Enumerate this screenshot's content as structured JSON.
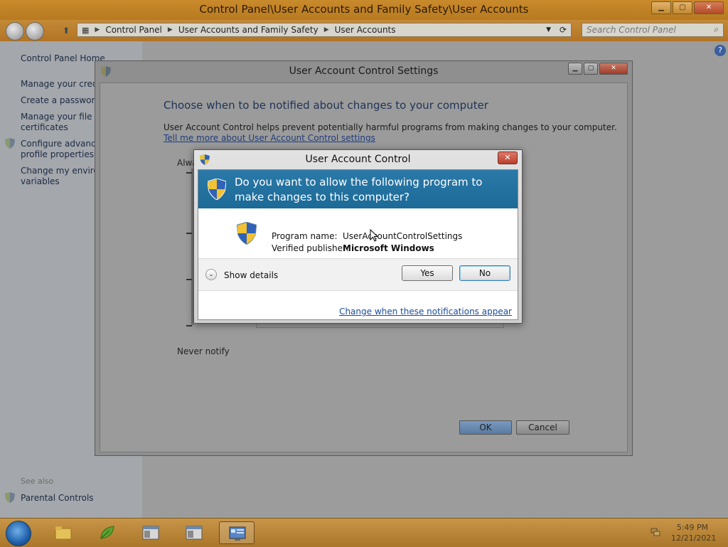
{
  "explorer": {
    "title": "Control Panel\\User Accounts and Family Safety\\User Accounts",
    "window_buttons": {
      "minimize": "▁",
      "maximize": "▢",
      "close": "✕"
    },
    "breadcrumb": [
      "Control Panel",
      "User Accounts and Family Safety",
      "User Accounts"
    ],
    "search_placeholder": "Search Control Panel",
    "left_pane": {
      "links": [
        "Control Panel Home",
        "Manage your crede",
        "Create a password r",
        "Manage your file er",
        "certificates",
        "Configure advance",
        "profile properties",
        "Change my environ",
        "variables"
      ],
      "see_also": "See also",
      "parental_controls": "Parental Controls"
    }
  },
  "uac_settings": {
    "title": "User Account Control Settings",
    "heading": "Choose when to be notified about changes to your computer",
    "description": "User Account Control helps prevent potentially harmful programs from making changes to your computer.",
    "learn_more_link": "Tell me more about User Account Control settings",
    "always_notify": "Alwa",
    "never_notify": "Never notify",
    "ok_label": "OK",
    "cancel_label": "Cancel"
  },
  "uac_dialog": {
    "title": "User Account Control",
    "close_label": "✕",
    "question": "Do you want to allow the following program to make changes to this computer?",
    "program_name_label": "Program name:",
    "program_name": "UserAccountControlSettings",
    "publisher_label": "Verified publisher:",
    "publisher": "Microsoft Windows",
    "show_details": "Show details",
    "yes_label": "Yes",
    "no_label": "No",
    "change_link": "Change when these notifications appear"
  },
  "taskbar": {
    "time": "5:49 PM",
    "date": "12/21/2021"
  },
  "colors": {
    "accent_orange": "#b87a20",
    "banner_blue": "#2a79a8",
    "link_blue": "#1a4a9a"
  }
}
